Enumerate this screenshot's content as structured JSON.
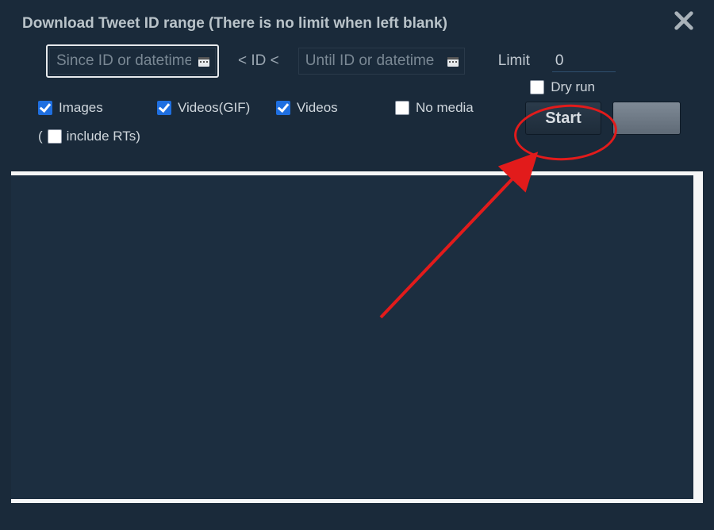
{
  "title": "Download Tweet ID range (There is no limit when left blank)",
  "range": {
    "since_placeholder": "Since ID or datetime",
    "since_value": "",
    "separator": "< ID <",
    "until_placeholder": "Until ID or datetime",
    "until_value": "",
    "limit_label": "Limit",
    "limit_value": "0"
  },
  "options": {
    "images": {
      "label": "Images",
      "checked": true
    },
    "videos_gif": {
      "label": "Videos(GIF)",
      "checked": true
    },
    "videos": {
      "label": "Videos",
      "checked": true
    },
    "no_media": {
      "label": "No media",
      "checked": false
    },
    "include_rts": {
      "label": "include RTs)",
      "prefix": "(",
      "checked": false
    },
    "dry_run": {
      "label": "Dry run",
      "checked": false
    }
  },
  "buttons": {
    "start": "Start",
    "secondary": ""
  },
  "icons": {
    "close": "✕",
    "calendar": "calendar-icon"
  }
}
